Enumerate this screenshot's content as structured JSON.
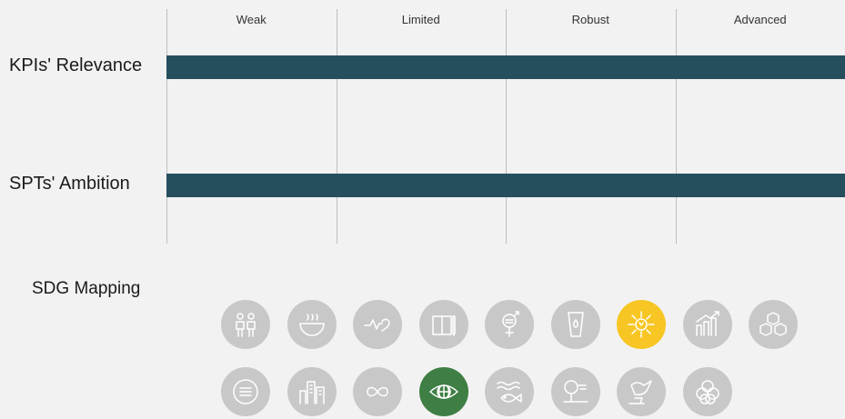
{
  "chart_data": {
    "type": "bar",
    "orientation": "horizontal",
    "scale_labels": [
      "Weak",
      "Limited",
      "Robust",
      "Advanced"
    ],
    "categories": [
      "KPIs' Relevance",
      "SPTs' Ambition"
    ],
    "values": [
      4,
      4
    ],
    "xlim": [
      0,
      4
    ],
    "grid": true,
    "bar_color": "#264f5e"
  },
  "sdg": {
    "title": "SDG Mapping",
    "inactive_color": "#c8c8c8",
    "icons": [
      {
        "name": "people-icon",
        "active": false
      },
      {
        "name": "food-bowl-icon",
        "active": false
      },
      {
        "name": "heartbeat-icon",
        "active": false
      },
      {
        "name": "book-icon",
        "active": false
      },
      {
        "name": "gender-equality-icon",
        "active": false
      },
      {
        "name": "water-drop-icon",
        "active": false
      },
      {
        "name": "sun-energy-icon",
        "active": true,
        "color": "#f7c624"
      },
      {
        "name": "growth-chart-icon",
        "active": false
      },
      {
        "name": "cubes-icon",
        "active": false
      },
      {
        "name": "equality-icon",
        "active": false
      },
      {
        "name": "city-buildings-icon",
        "active": false
      },
      {
        "name": "infinity-loop-icon",
        "active": false
      },
      {
        "name": "eye-globe-icon",
        "active": true,
        "color": "#3f7e44"
      },
      {
        "name": "fish-icon",
        "active": false
      },
      {
        "name": "tree-land-icon",
        "active": false
      },
      {
        "name": "dove-gavel-icon",
        "active": false
      },
      {
        "name": "flower-rings-icon",
        "active": false
      }
    ]
  }
}
